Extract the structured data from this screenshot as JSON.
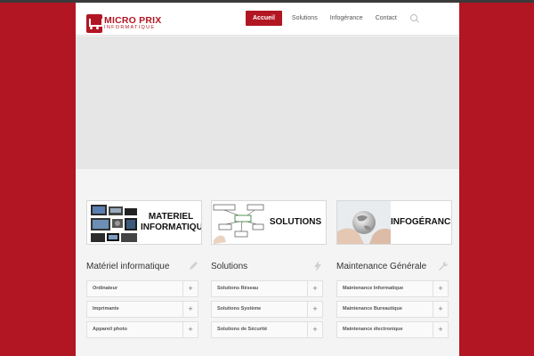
{
  "header": {
    "logo_title": "MICRO PRIX",
    "logo_subtitle": "INFORMATIQUE",
    "nav": [
      "Accueil",
      "Solutions",
      "Infogérance",
      "Contact"
    ],
    "active_nav": "Accueil",
    "search_icon": "search-icon"
  },
  "banners": [
    {
      "line1": "MATERIEL",
      "line2": "INFORMATIQUE"
    },
    {
      "line1": "SOLUTIONS",
      "line2": ""
    },
    {
      "line1": "INFOGÉRANCE",
      "line2": ""
    }
  ],
  "sections": [
    {
      "title": "Matériel informatique",
      "icon": "pencil-icon",
      "items": [
        "Ordinateur",
        "Imprimante",
        "Appareil photo"
      ]
    },
    {
      "title": "Solutions",
      "icon": "lightning-icon",
      "items": [
        "Solutions Réseau",
        "Solutions Système",
        "Solutions de Sécurité"
      ]
    },
    {
      "title": "Maintenance Générale",
      "icon": "wrench-icon",
      "items": [
        "Maintenance Informatique",
        "Maintenance Bureautique",
        "Maintenance électronique"
      ]
    }
  ],
  "colors": {
    "brand": "#b21622",
    "background": "#f4f4f4",
    "slider": "#e6e6e6"
  }
}
